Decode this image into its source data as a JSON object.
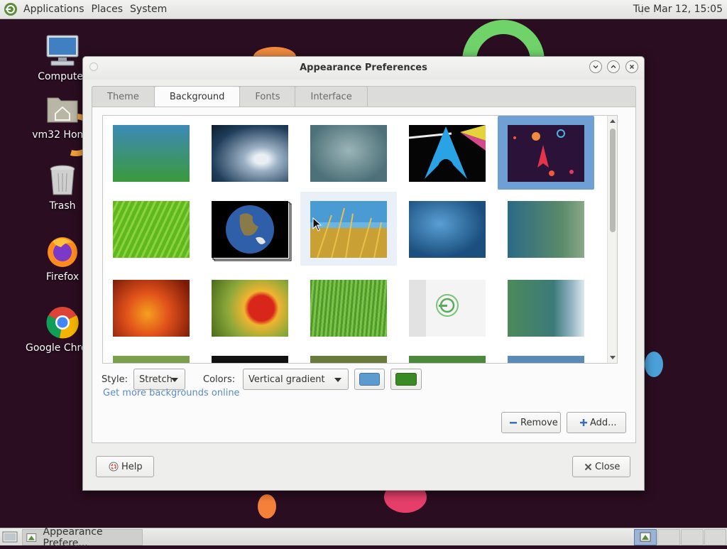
{
  "top_panel": {
    "menus": [
      "Applications",
      "Places",
      "System"
    ],
    "clock": "Tue Mar 12, 15:05"
  },
  "desktop": {
    "icons": [
      {
        "label": "Computer",
        "icon": "computer-icon"
      },
      {
        "label": "vm32 Home",
        "icon": "home-folder-icon"
      },
      {
        "label": "Trash",
        "icon": "trash-icon"
      },
      {
        "label": "Firefox",
        "icon": "firefox-icon"
      },
      {
        "label": "Google Chrome",
        "icon": "chrome-icon"
      }
    ]
  },
  "window": {
    "title": "Appearance Preferences",
    "tabs": [
      "Theme",
      "Background",
      "Fonts",
      "Interface"
    ],
    "active_tab": "Background",
    "gallery": {
      "selected_index": 4,
      "hovered_index": 7,
      "rows": [
        [
          "green-blue-gradient",
          "water-drop",
          "misty-lake",
          "arch-logo-prism",
          "space-rockets"
        ],
        [
          "green-leaf",
          "earth-globe",
          "grass-sky",
          "blue-waves-bubbles",
          "teal-bokeh"
        ],
        [
          "orange-flower",
          "red-flower",
          "green-grass",
          "mate-logo",
          "blue-abstract"
        ]
      ]
    },
    "style": {
      "label": "Style:",
      "value": "Stretch"
    },
    "colors": {
      "label": "Colors:",
      "value": "Vertical gradient",
      "primary": "#5b9bd0",
      "secondary": "#3a8a24"
    },
    "online_link": "Get more backgrounds online",
    "remove_label": "Remove",
    "add_label": "Add...",
    "help_label": "Help",
    "close_label": "Close"
  },
  "taskbar": {
    "task_label": "Appearance Prefere..."
  },
  "colors": {
    "desktop_bg": "#2a0d20",
    "selection": "#6ea0d6",
    "link": "#5a8bc2"
  }
}
